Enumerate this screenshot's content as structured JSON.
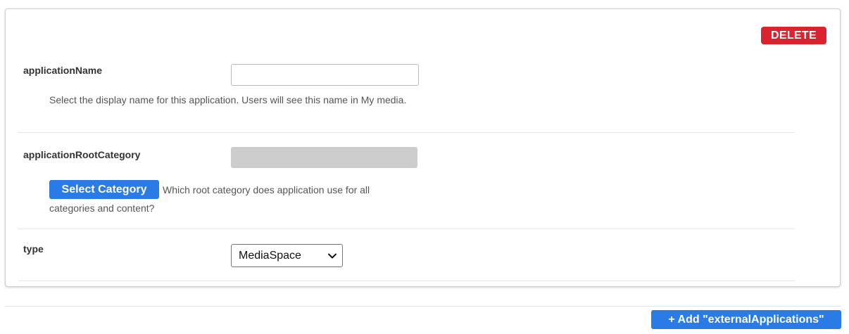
{
  "card": {
    "delete_label": "DELETE",
    "fields": {
      "application_name": {
        "label": "applicationName",
        "value": "",
        "help": "Select the display name for this application. Users will see this name in My media."
      },
      "application_root_category": {
        "label": "applicationRootCategory",
        "button_label": "Select Category",
        "help_inline": "Which root category does application use for all",
        "help_continued": "categories and content?"
      },
      "type": {
        "label": "type",
        "selected": "MediaSpace"
      }
    }
  },
  "footer": {
    "add_label": "+ Add \"externalApplications\""
  },
  "colors": {
    "danger": "#d9232e",
    "primary": "#2a7be6",
    "disabled_fill": "#cccccc"
  },
  "icons": {
    "select_chevron": "chevron-down-icon"
  }
}
